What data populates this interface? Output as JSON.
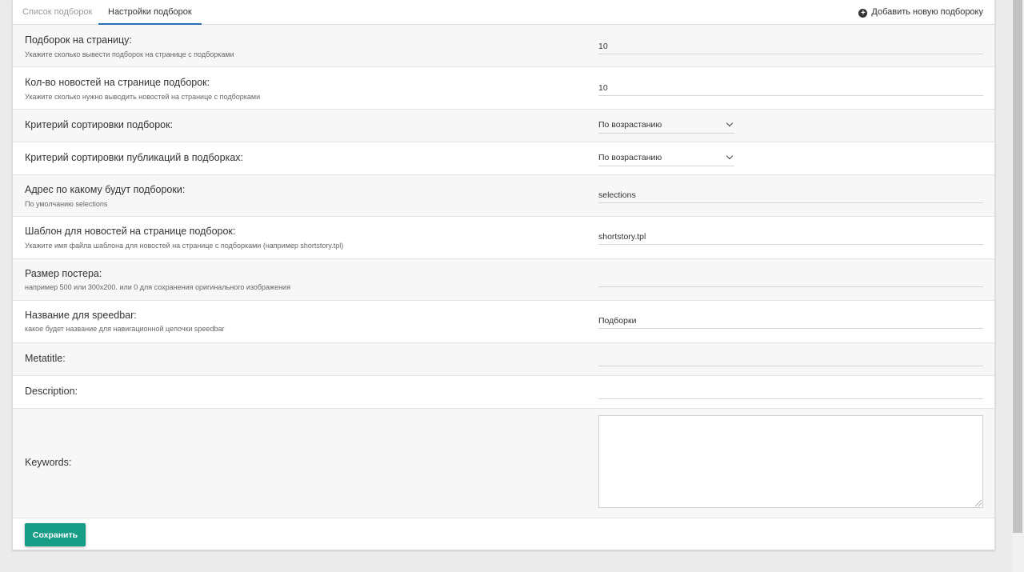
{
  "tabs": [
    {
      "label": "Список подборок",
      "active": false
    },
    {
      "label": "Настройки подборок",
      "active": true
    }
  ],
  "header": {
    "add_label": "Добавить новую подбороку",
    "add_icon": "plus-circle-icon"
  },
  "settings": {
    "per_page": {
      "label": "Подборок на страницу:",
      "hint": "Укажите сколько вывести подборок на странице с подборками",
      "value": "10"
    },
    "news_count": {
      "label": "Кол-во новостей на странице подборок:",
      "hint": "Укажите сколько нужно выводить новостей на странице с подборками",
      "value": "10"
    },
    "sort_selections": {
      "label": "Критерий сортировки подборок:",
      "value": "По возрастанию"
    },
    "sort_publications": {
      "label": "Критерий сортировки публикаций в подборках:",
      "value": "По возрастанию"
    },
    "address": {
      "label": "Адрес по какому будут подбороки:",
      "hint": "По умолчанию selections",
      "value": "selections"
    },
    "template": {
      "label": "Шаблон для новостей на странице подборок:",
      "hint": "Укажите имя файла шаблона для новостей на странице с подборками (например shortstory.tpl)",
      "value": "shortstory.tpl"
    },
    "poster_size": {
      "label": "Размер постера:",
      "hint": "например 500 или 300x200. или 0 для сохранения оригинального изображения",
      "value": ""
    },
    "speedbar": {
      "label": "Название для speedbar:",
      "hint": "какое будет название для навигационной цепочки speedbar",
      "value": "Подборки"
    },
    "metatitle": {
      "label": "Metatitle:",
      "value": ""
    },
    "description": {
      "label": "Description:",
      "value": ""
    },
    "keywords": {
      "label": "Keywords:",
      "value": ""
    }
  },
  "save_label": "Сохранить",
  "colors": {
    "accent": "#179c86",
    "tab_underline": "#2a6fb0"
  }
}
